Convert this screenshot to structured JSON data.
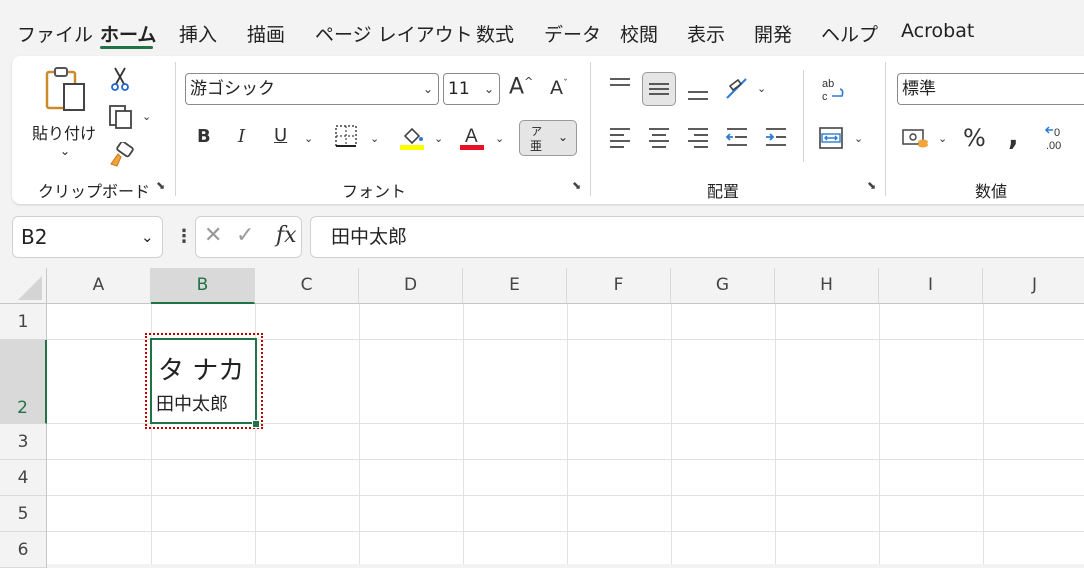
{
  "menu": {
    "tabs": [
      "ファイル",
      "ホーム",
      "挿入",
      "描画",
      "ページ レイアウト",
      "数式",
      "データ",
      "校閲",
      "表示",
      "開発",
      "ヘルプ",
      "Acrobat"
    ],
    "active": "ホーム"
  },
  "ribbon": {
    "clipboard": {
      "paste_label": "貼り付け",
      "group_label": "クリップボード"
    },
    "font": {
      "font_name": "游ゴシック",
      "font_size": "11",
      "group_label": "フォント",
      "font_color": "#e81123",
      "fill_color": "#ffff00",
      "phonetic_top": "ア",
      "phonetic_bottom": "亜"
    },
    "alignment": {
      "group_label": "配置"
    },
    "number": {
      "format": "標準",
      "group_label": "数値"
    }
  },
  "formula_bar": {
    "name_box": "B2",
    "formula": "田中太郎"
  },
  "grid": {
    "columns": [
      "A",
      "B",
      "C",
      "D",
      "E",
      "F",
      "G",
      "H",
      "I",
      "J"
    ],
    "rows": [
      "1",
      "2",
      "3",
      "4",
      "5",
      "6"
    ],
    "cell_b2": {
      "phonetic": "タ ナカ",
      "value": "田中太郎"
    }
  },
  "colors": {
    "accent": "#217346",
    "selection_dotted": "#c00000"
  }
}
